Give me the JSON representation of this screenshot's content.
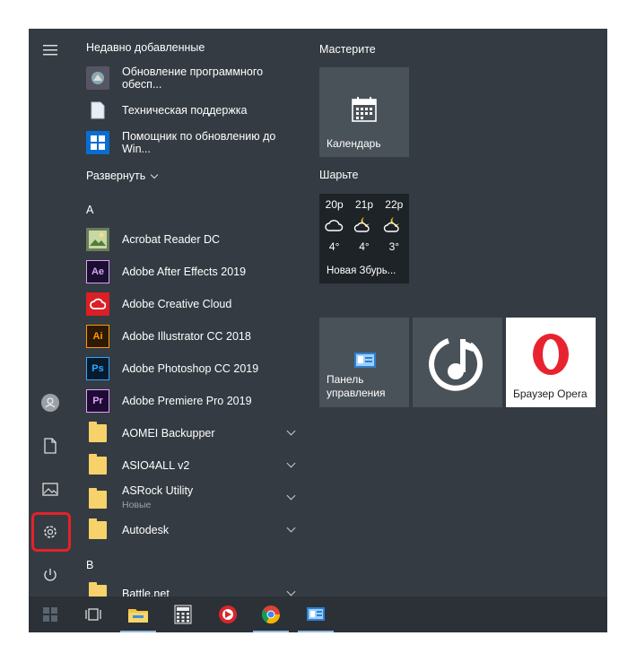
{
  "recent": {
    "header": "Недавно добавленные",
    "items": [
      {
        "label": "Обновление программного обесп...",
        "icon": "software-update-icon"
      },
      {
        "label": "Техническая поддержка",
        "icon": "document-icon"
      },
      {
        "label": "Помощник по обновлению до Win...",
        "icon": "windows-logo-icon"
      }
    ]
  },
  "expand_label": "Развернуть",
  "letters": {
    "a": "A",
    "b": "B"
  },
  "apps": [
    {
      "label": "Acrobat Reader DC",
      "icon": "acrobat-icon",
      "badge": ""
    },
    {
      "label": "Adobe After Effects 2019",
      "icon": "after-effects-icon",
      "badge": "Ae",
      "color": "#1a0f2e",
      "fg": "#d8a1ff"
    },
    {
      "label": "Adobe Creative Cloud",
      "icon": "creative-cloud-icon",
      "badge": "",
      "color": "#da1f26"
    },
    {
      "label": "Adobe Illustrator CC 2018",
      "icon": "illustrator-icon",
      "badge": "Ai",
      "color": "#2d1a05",
      "fg": "#ff9a00"
    },
    {
      "label": "Adobe Photoshop CC 2019",
      "icon": "photoshop-icon",
      "badge": "Ps",
      "color": "#061b2e",
      "fg": "#31a8ff"
    },
    {
      "label": "Adobe Premiere Pro 2019",
      "icon": "premiere-icon",
      "badge": "Pr",
      "color": "#1d0b33",
      "fg": "#e3a1ff"
    }
  ],
  "folders": [
    {
      "label": "AOMEI Backupper",
      "sub": ""
    },
    {
      "label": "ASIO4ALL v2",
      "sub": ""
    },
    {
      "label": "ASRock Utility",
      "sub": "Новые"
    },
    {
      "label": "Autodesk",
      "sub": ""
    }
  ],
  "b_folder": {
    "label": "Battle.net"
  },
  "groups": {
    "create": "Мастерите",
    "explore": "Шарьте"
  },
  "tiles": {
    "calendar": "Календарь",
    "weather": {
      "location": "Новая Збурь...",
      "hours": [
        "20р",
        "21р",
        "22р"
      ],
      "temps": [
        "4°",
        "4°",
        "3°"
      ]
    },
    "control_panel": {
      "line1": "Панель",
      "line2": "управления"
    },
    "groove": "",
    "opera": "Браузер Opera"
  },
  "colors": {
    "accent_highlight": "#e5212a",
    "start_bg": "#343b42",
    "tile_bg": "#4a5259"
  }
}
